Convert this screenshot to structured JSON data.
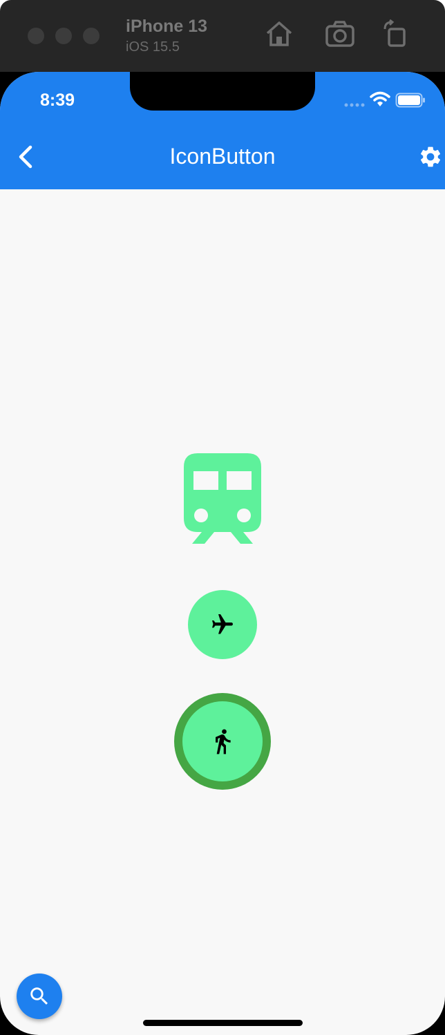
{
  "simulator": {
    "device_name": "iPhone 13",
    "os_version": "iOS 15.5",
    "toolbar_icons": [
      "home-icon",
      "screenshot-icon",
      "rotate-icon"
    ]
  },
  "status_bar": {
    "time": "8:39",
    "icons": [
      "signal-icon",
      "wifi-icon",
      "battery-icon"
    ]
  },
  "app_bar": {
    "title": "IconButton",
    "leading_icon": "back-chevron-icon",
    "trailing_icon": "settings-gear-icon",
    "color": "#1e80ef"
  },
  "buttons": [
    {
      "icon": "train-icon",
      "style": "plain",
      "color": "#5ef19b"
    },
    {
      "icon": "airplane-icon",
      "style": "filled-circle",
      "color": "#5ef19b"
    },
    {
      "icon": "directions-walk-icon",
      "style": "filled-circle-with-border",
      "color": "#5ef19b",
      "border_color": "#45a644"
    }
  ],
  "fab": {
    "icon": "search-icon",
    "color": "#1e80ef"
  }
}
